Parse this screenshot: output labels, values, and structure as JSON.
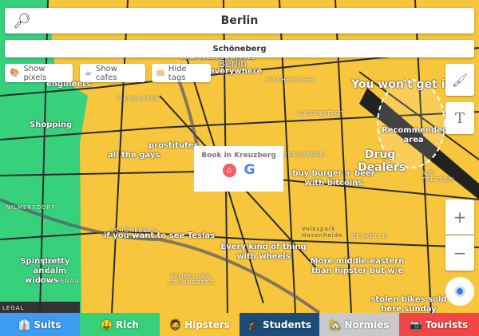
{
  "search": {
    "value": "Berlin",
    "icon": "magnifier-icon"
  },
  "district": "Schöneberg",
  "chips": [
    {
      "icon": "pixels-icon",
      "label": "Show pixels"
    },
    {
      "icon": "coffee-icon",
      "label": "Show cafes"
    },
    {
      "icon": "tag-icon",
      "label": "Hide tags"
    }
  ],
  "tools": {
    "brush": "brush-icon",
    "text": "T",
    "zoom_in": "+",
    "zoom_out": "−"
  },
  "popup": {
    "title": "Book in Kreuzberg",
    "airbnb": "airbnb-icon",
    "google": "G"
  },
  "tags": [
    "tourists, tourists",
    "everywhere",
    "engineers",
    "Shopping",
    "prostitutes",
    "all the gays",
    "You won't get in",
    "Recommended area",
    "Drug Dealers",
    "buy burger + beer with bitcoins",
    "if you want to see Teslas",
    "Every kind of thing with wheels",
    "Spinsters and widows",
    "pretty calm",
    "More middle-eastern than hipster but w/e",
    "stolen bikes sold here sunday"
  ],
  "places": [
    "Berlin",
    "TIERGARTEN",
    "KREUZBERG",
    "WILMERSDORF",
    "SCHÖNEBERG",
    "FRIEDENAU",
    "TEMPELHOF-SCHÖNEBERG",
    "NEUKÖLLN",
    "ALT-TREPTOW",
    "LUISENSTADT",
    "FISCHERINSEL",
    "Volkspark Hasenheide",
    "LEGAL"
  ],
  "tabs": [
    {
      "label": "Suits",
      "icon": "👔",
      "color": "#3b9cf0"
    },
    {
      "label": "Rich",
      "icon": "🤑",
      "color": "#37d17c"
    },
    {
      "label": "Hipsters",
      "icon": "🧔",
      "color": "#f7c63c"
    },
    {
      "label": "Students",
      "icon": "🎓",
      "color": "#1c4d7a"
    },
    {
      "label": "Normies",
      "icon": "🏡",
      "color": "#c9c9c9"
    },
    {
      "label": "Tourists",
      "icon": "📷",
      "color": "#f04646"
    }
  ]
}
